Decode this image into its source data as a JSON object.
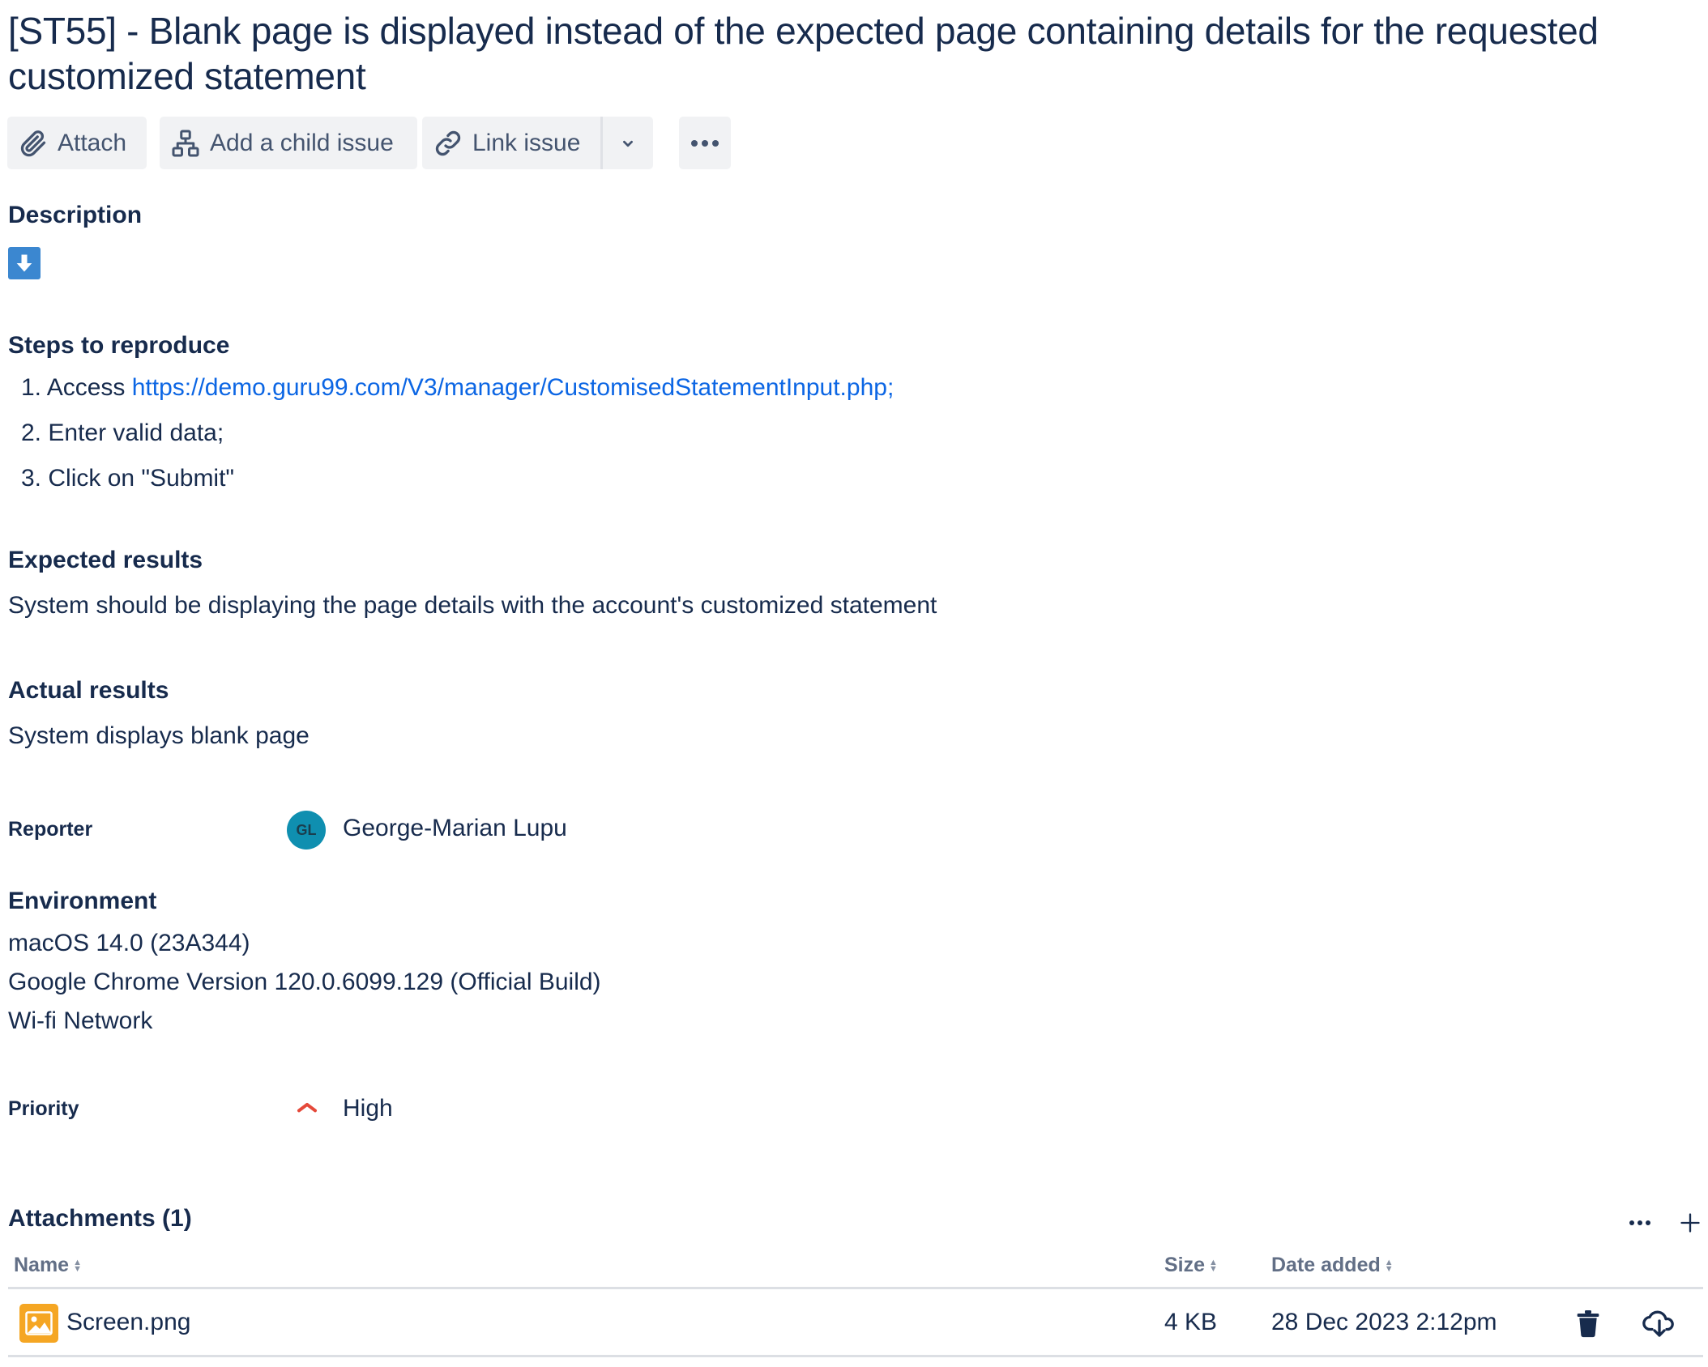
{
  "issue": {
    "title": "[ST55] - Blank page is displayed instead of the expected page containing details for the requested customized statement"
  },
  "toolbar": {
    "attach_label": "Attach",
    "add_child_label": "Add a child issue",
    "link_issue_label": "Link issue"
  },
  "description": {
    "heading": "Description",
    "steps_heading": "Steps to reproduce",
    "steps": [
      {
        "number": "1.",
        "prefix": "Access ",
        "link": "https://demo.guru99.com/V3/manager/CustomisedStatementInput.php;"
      },
      {
        "number": "2.",
        "text": "Enter valid data;"
      },
      {
        "number": "3.",
        "text": "Click on \"Submit\""
      }
    ],
    "expected_heading": "Expected results",
    "expected_text": "System should be displaying the page details with the account's customized statement",
    "actual_heading": "Actual results",
    "actual_text": "System displays blank page"
  },
  "reporter": {
    "label": "Reporter",
    "initials": "GL",
    "name": "George-Marian Lupu",
    "avatar_color": "#0f8fb0"
  },
  "environment": {
    "heading": "Environment",
    "lines": [
      "macOS 14.0 (23A344)",
      "Google Chrome Version 120.0.6099.129 (Official Build)",
      "Wi-fi Network"
    ]
  },
  "priority": {
    "label": "Priority",
    "value": "High",
    "icon": "priority-high-icon",
    "color": "#e5493a"
  },
  "attachments": {
    "heading": "Attachments (1)",
    "columns": {
      "name": "Name",
      "size": "Size",
      "date": "Date added"
    },
    "rows": [
      {
        "name": "Screen.png",
        "size": "4 KB",
        "date": "28 Dec 2023 2:12pm",
        "icon": "image-file-icon",
        "icon_color": "#f5a623"
      }
    ]
  },
  "colors": {
    "text": "#172b4d",
    "subtle": "#44546f",
    "link": "#0c66e4",
    "button_bg": "#f1f2f4",
    "collapse_button": "#3b87d0"
  }
}
